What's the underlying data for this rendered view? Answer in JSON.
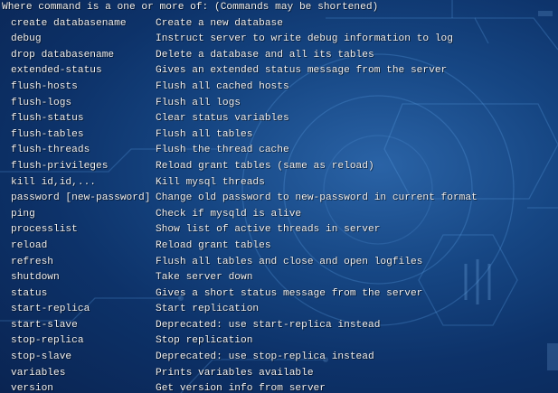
{
  "intro": "Where command is a one or more of: (Commands may be shortened)",
  "commands": [
    {
      "command": "create databasename",
      "description": "Create a new database"
    },
    {
      "command": "debug",
      "description": "Instruct server to write debug information to log"
    },
    {
      "command": "drop databasename",
      "description": "Delete a database and all its tables"
    },
    {
      "command": "extended-status",
      "description": "Gives an extended status message from the server"
    },
    {
      "command": "flush-hosts",
      "description": "Flush all cached hosts"
    },
    {
      "command": "flush-logs",
      "description": "Flush all logs"
    },
    {
      "command": "flush-status",
      "description": "Clear status variables"
    },
    {
      "command": "flush-tables",
      "description": "Flush all tables"
    },
    {
      "command": "flush-threads",
      "description": "Flush the thread cache"
    },
    {
      "command": "flush-privileges",
      "description": "Reload grant tables (same as reload)"
    },
    {
      "command": "kill id,id,...",
      "description": "Kill mysql threads"
    },
    {
      "command": "password [new-password]",
      "description": "Change old password to new-password in current format"
    },
    {
      "command": "ping",
      "description": "Check if mysqld is alive"
    },
    {
      "command": "processlist",
      "description": "Show list of active threads in server"
    },
    {
      "command": "reload",
      "description": "Reload grant tables"
    },
    {
      "command": "refresh",
      "description": "Flush all tables and close and open logfiles"
    },
    {
      "command": "shutdown",
      "description": "Take server down"
    },
    {
      "command": "status",
      "description": "Gives a short status message from the server"
    },
    {
      "command": "start-replica",
      "description": "Start replication"
    },
    {
      "command": "start-slave",
      "description": "Deprecated: use start-replica instead"
    },
    {
      "command": "stop-replica",
      "description": "Stop replication"
    },
    {
      "command": "stop-slave",
      "description": "Deprecated: use stop-replica instead"
    },
    {
      "command": "variables",
      "description": "Prints variables available"
    },
    {
      "command": "version",
      "description": "Get version info from server"
    }
  ],
  "colors": {
    "text": "#f2f4f8",
    "background": "#123d76",
    "accent": "#5ea2e6"
  }
}
